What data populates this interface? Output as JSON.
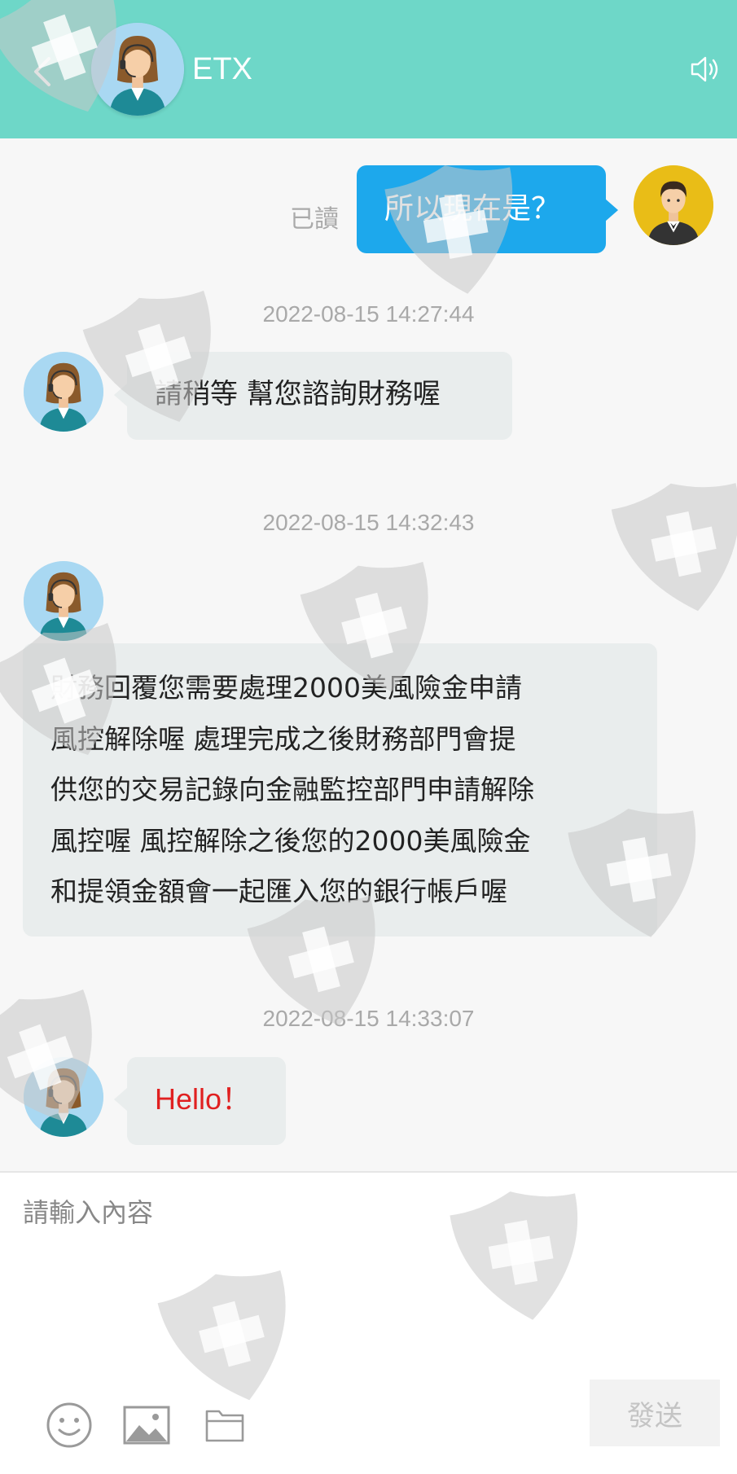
{
  "header": {
    "title": "ETX",
    "back_icon": "chevron-left-icon",
    "speaker_icon": "speaker-icon",
    "background_color": "#6ed7c8"
  },
  "messages": {
    "out_1": {
      "text": "所以現在是？",
      "read_label": "已讀"
    },
    "ts_1": "2022-08-15 14:27:44",
    "in_1": {
      "text": "請稍等 幫您諮詢財務喔"
    },
    "ts_2": "2022-08-15 14:32:43",
    "in_2": {
      "lines": [
        "財務回覆您需要處理2000美風險金申請",
        "風控解除喔 處理完成之後財務部門會提",
        "供您的交易記錄向金融監控部門申請解除",
        "風控喔 風控解除之後您的2000美風險金",
        "和提領金額會一起匯入您的銀行帳戶喔"
      ]
    },
    "ts_3": "2022-08-15 14:33:07",
    "in_3": {
      "text": "Hello！",
      "color": "#e02020"
    }
  },
  "composer": {
    "placeholder": "請輸入內容",
    "value": "",
    "send_label": "發送",
    "tools": [
      "emoji-icon",
      "image-icon",
      "folder-icon"
    ]
  },
  "colors": {
    "outgoing_bubble": "#1da8ec",
    "incoming_bubble": "#e9eded",
    "timestamp": "#a9a9a9"
  }
}
